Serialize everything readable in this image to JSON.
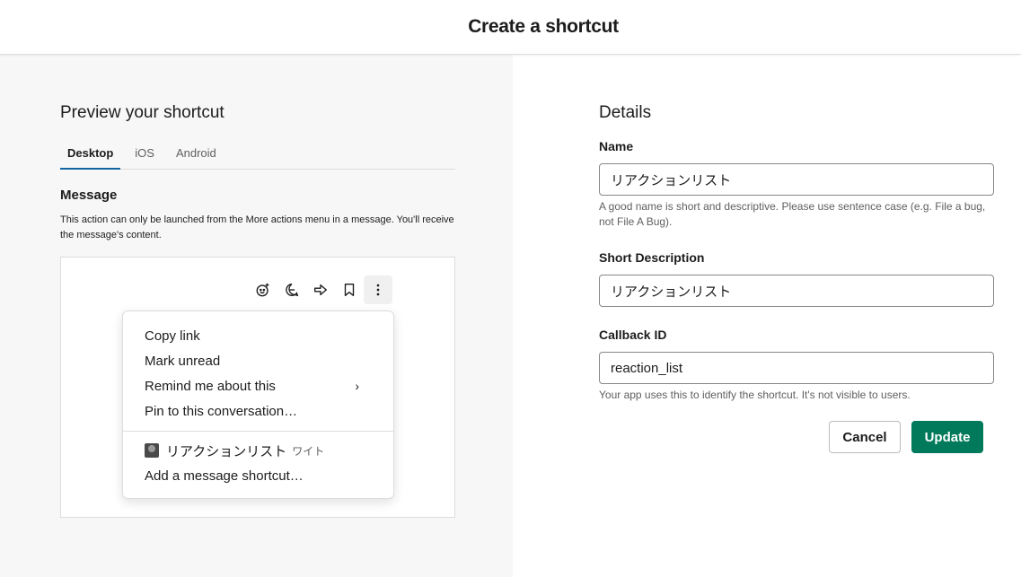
{
  "header": {
    "title": "Create a shortcut"
  },
  "preview": {
    "title": "Preview your shortcut",
    "tabs": [
      {
        "label": "Desktop",
        "active": true
      },
      {
        "label": "iOS",
        "active": false
      },
      {
        "label": "Android",
        "active": false
      }
    ],
    "message_title": "Message",
    "message_desc": "This action can only be launched from the More actions menu in a message. You'll receive the message's content.",
    "toolbar_icons": [
      "emoji-reaction-icon",
      "reply-thread-icon",
      "share-arrow-icon",
      "bookmark-icon",
      "more-actions-icon"
    ],
    "menu": {
      "items": [
        "Copy link",
        "Mark unread",
        "Remind me about this",
        "Pin to this conversation…"
      ],
      "app_shortcut_name": "リアクションリスト",
      "app_shortcut_sub": "ワイト",
      "add_shortcut": "Add a message shortcut…"
    }
  },
  "details": {
    "title": "Details",
    "name_label": "Name",
    "name_value": "リアクションリスト",
    "name_hint": "A good name is short and descriptive. Please use sentence case (e.g. File a bug, not File A Bug).",
    "short_desc_label": "Short Description",
    "short_desc_value": "リアクションリスト",
    "callback_label": "Callback ID",
    "callback_value": "reaction_list",
    "callback_hint": "Your app uses this to identify the shortcut. It's not visible to users.",
    "cancel_label": "Cancel",
    "update_label": "Update"
  },
  "colors": {
    "primary": "#007a5a",
    "tab_active": "#1264a3"
  }
}
